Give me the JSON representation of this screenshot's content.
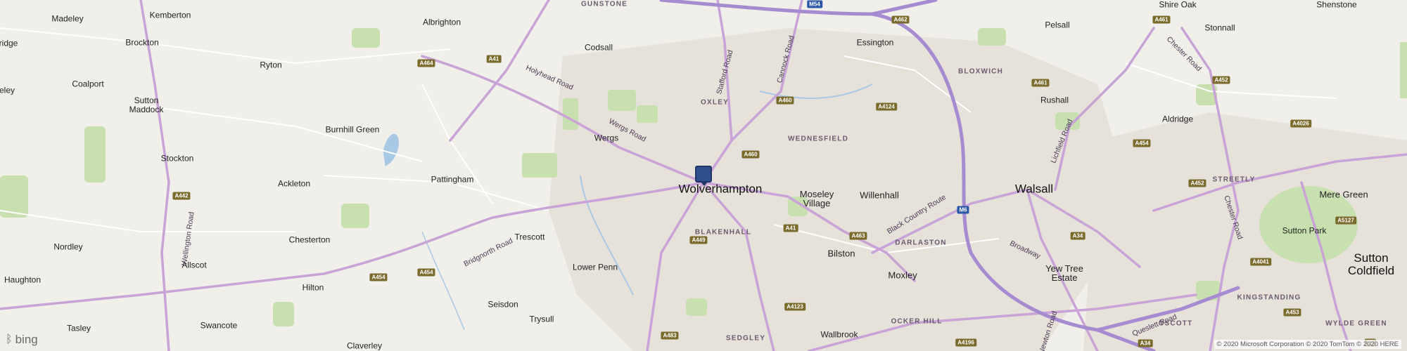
{
  "map": {
    "provider": "bing",
    "copyright": "© 2020 Microsoft Corporation © 2020 TomTom © 2020 HERE",
    "marker": {
      "label": "Wolverhampton",
      "icon": "map-pin-icon"
    }
  },
  "places": {
    "madeley": "Madeley",
    "kemberton": "Kemberton",
    "albrighton": "Albrighton",
    "brockton": "Brockton",
    "coalport": "Coalport",
    "ryton": "Ryton",
    "sutton_maddock": "Sutton\nMaddock",
    "codsall": "Codsall",
    "essington": "Essington",
    "pelsall": "Pelsall",
    "shire_oak": "Shire Oak",
    "shenstone": "Shenstone",
    "stonnall": "Stonnall",
    "rushall": "Rushall",
    "aldridge": "Aldridge",
    "burnhill_green": "Burnhill Green",
    "wergs": "Wergs",
    "stockton": "Stockton",
    "ackleton": "Ackleton",
    "pattingham": "Pattingham",
    "wolverhampton": "Wolverhampton",
    "moseley_village": "Moseley\nVillage",
    "willenhall": "Willenhall",
    "walsall": "Walsall",
    "mere_green": "Mere Green",
    "chesterton": "Chesterton",
    "trescott": "Trescott",
    "nordley": "Nordley",
    "allscot": "Allscot",
    "lower_penn": "Lower Penn",
    "bilston": "Bilston",
    "moxley": "Moxley",
    "yew_tree_estate": "Yew Tree\nEstate",
    "sutton_park": "Sutton Park",
    "sutton_coldfield": "Sutton\nColdfield",
    "haughton": "Haughton",
    "hilton": "Hilton",
    "swancote": "Swancote",
    "seisdon": "Seisdon",
    "trysull": "Trysull",
    "wallbrook": "Wallbrook",
    "tasley": "Tasley",
    "claverley": "Claverley",
    "bridge": "ridge",
    "eley": "eley"
  },
  "districts": {
    "gunstone": "GUNSTONE",
    "oxley": "OXLEY",
    "bloxwich": "BLOXWICH",
    "wednesfield": "WEDNESFIELD",
    "blakenhall": "BLAKENHALL",
    "darlaston": "DARLASTON",
    "streetly": "STREETLY",
    "kingstanding": "KINGSTANDING",
    "ocker_hill": "OCKER HILL",
    "sedgley": "SEDGLEY",
    "oscott": "OSCOTT",
    "wylde_green": "WYLDE GREEN"
  },
  "roads": {
    "holyhead_road": "Holyhead Road",
    "wergs_road": "Wergs Road",
    "stafford_road": "Stafford Road",
    "cannock_road": "Cannock Road",
    "bridgnorth_road": "Bridgnorth Road",
    "wellington_road": "Wellington Road",
    "black_country_route": "Black Country Route",
    "broadway": "Broadway",
    "lichfield_road": "Lichfield Road",
    "chester_road_n": "Chester Road",
    "chester_road_s": "Chester Road",
    "queslett_road": "Queslett Road",
    "newton_road": "Newton Road"
  },
  "shields": {
    "m54": "M54",
    "m6": "M6",
    "a41_w": "A41",
    "a464": "A464",
    "a462": "A462",
    "a460_n": "A460",
    "a460_c": "A460",
    "a4124": "A4124",
    "a461_n": "A461",
    "a461_e": "A461",
    "a452_n": "A452",
    "a452_s": "A452",
    "a4026": "A4026",
    "a454_e": "A454",
    "a454_w": "A454",
    "a454_sw": "A454",
    "a5127": "A5127",
    "a442": "A442",
    "a41_c": "A41",
    "a449": "A449",
    "a463": "A463",
    "a34_n": "A34",
    "a34_s": "A34",
    "a4041": "A4041",
    "a453": "A453",
    "a4123": "A4123",
    "a483": "A483",
    "a4196": "A4196",
    "a5_se": "A5"
  },
  "colors": {
    "background": "#f1efe9",
    "water": "#a8c8e6",
    "green": "#c7dfae",
    "motorway": "#a78bd0",
    "major_road": "#c7a0d6",
    "minor_road": "#ffffff",
    "urban": "#e8e4dc",
    "marker": "#2e4f8c"
  }
}
